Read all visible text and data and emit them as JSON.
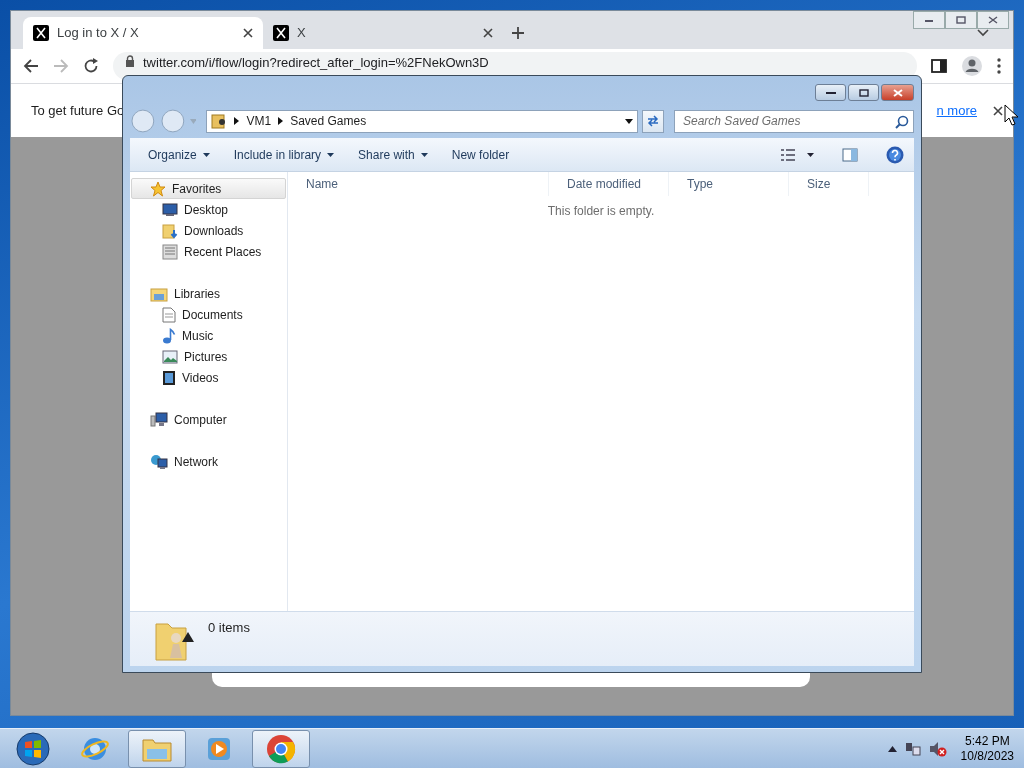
{
  "browser": {
    "tabs": [
      {
        "title": "Log in to X / X",
        "selected": true
      },
      {
        "title": "X",
        "selected": false
      }
    ],
    "address": "twitter.com/i/flow/login?redirect_after_login=%2FNekOwn3D",
    "forward_disabled": true,
    "infobar": {
      "message": "To get future Go",
      "link": "n more"
    }
  },
  "explorer": {
    "breadcrumb": [
      "VM1",
      "Saved Games"
    ],
    "search": {
      "placeholder": "Search Saved Games"
    },
    "toolbar": [
      {
        "label": "Organize",
        "dropdown": true
      },
      {
        "label": "Include in library",
        "dropdown": true
      },
      {
        "label": "Share with",
        "dropdown": true
      },
      {
        "label": "New folder",
        "dropdown": false
      }
    ],
    "nav": [
      {
        "label": "Favorites",
        "kind": "star",
        "selected": true,
        "children": [
          {
            "label": "Desktop",
            "kind": "desktop",
            "selected": false
          },
          {
            "label": "Downloads",
            "kind": "downloads",
            "selected": false
          },
          {
            "label": "Recent Places",
            "kind": "recent",
            "selected": false
          }
        ]
      },
      {
        "label": "Libraries",
        "kind": "libraries",
        "selected": false,
        "children": [
          {
            "label": "Documents",
            "kind": "document",
            "selected": false
          },
          {
            "label": "Music",
            "kind": "music",
            "selected": false
          },
          {
            "label": "Pictures",
            "kind": "pictures",
            "selected": false
          },
          {
            "label": "Videos",
            "kind": "videos",
            "selected": false
          }
        ]
      },
      {
        "label": "Computer",
        "kind": "computer",
        "selected": false
      },
      {
        "label": "Network",
        "kind": "network",
        "selected": false
      }
    ],
    "columns": [
      "Name",
      "Date modified",
      "Type",
      "Size"
    ],
    "empty_message": "This folder is empty.",
    "status": "0 items"
  },
  "taskbar": {
    "apps": [
      {
        "kind": "ie",
        "active": false
      },
      {
        "kind": "explorer",
        "active": true
      },
      {
        "kind": "media",
        "active": false
      },
      {
        "kind": "chrome",
        "active": true
      }
    ],
    "clock": {
      "time": "5:42 PM",
      "date": "10/8/2023"
    }
  }
}
